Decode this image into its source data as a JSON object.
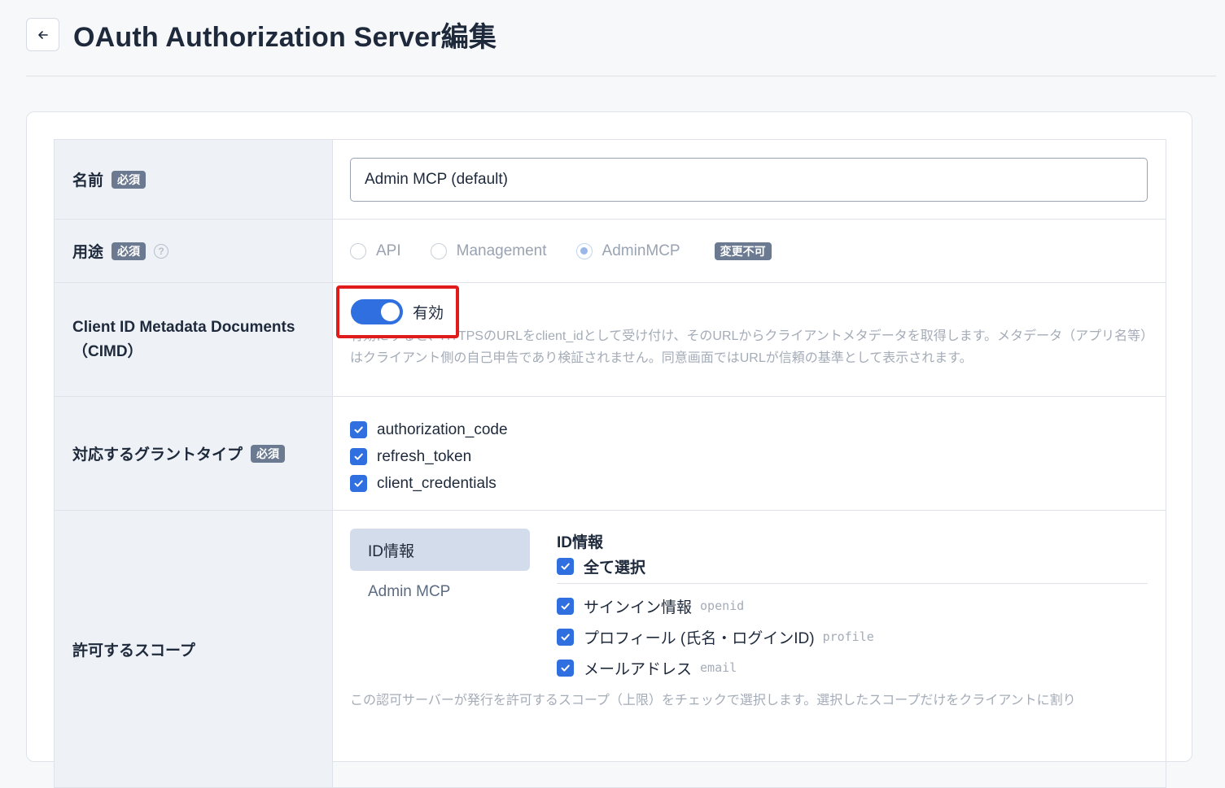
{
  "header": {
    "title": "OAuth Authorization Server編集"
  },
  "form": {
    "name": {
      "label": "名前",
      "required": "必須",
      "value": "Admin MCP (default)"
    },
    "usage": {
      "label": "用途",
      "required": "必須",
      "options": [
        "API",
        "Management",
        "AdminMCP"
      ],
      "selected": "AdminMCP",
      "locked": "変更不可"
    },
    "cimd": {
      "label": "Client ID Metadata Documents（CIMD）",
      "toggle_label": "有効",
      "help": "有効にすると、HTTPSのURLをclient_idとして受け付け、そのURLからクライアントメタデータを取得します。メタデータ（アプリ名等）はクライアント側の自己申告であり検証されません。同意画面ではURLが信頼の基準として表示されます。"
    },
    "grants": {
      "label": "対応するグラントタイプ",
      "required": "必須",
      "items": [
        "authorization_code",
        "refresh_token",
        "client_credentials"
      ]
    },
    "scopes": {
      "label": "許可するスコープ",
      "tabs": [
        "ID情報",
        "Admin MCP"
      ],
      "panel_title": "ID情報",
      "select_all": "全て選択",
      "items": [
        {
          "label": "サインイン情報",
          "code": "openid"
        },
        {
          "label": "プロフィール (氏名・ログインID)",
          "code": "profile"
        },
        {
          "label": "メールアドレス",
          "code": "email"
        }
      ],
      "help": "この認可サーバーが発行を許可するスコープ（上限）をチェックで選択します。選択したスコープだけをクライアントに割り"
    }
  },
  "colors": {
    "accent": "#2f6fe0",
    "highlight": "#e01b1b"
  }
}
